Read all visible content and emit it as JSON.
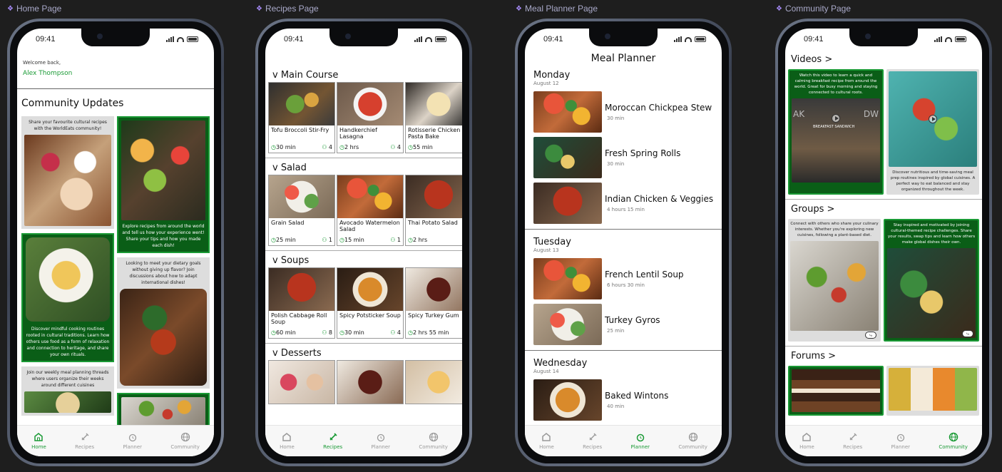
{
  "frames": [
    "Home Page",
    "Recipes Page",
    "Meal Planner Page",
    "Community Page"
  ],
  "status": {
    "time": "09:41"
  },
  "tabs": [
    "Home",
    "Recipes",
    "Planner",
    "Community"
  ],
  "colors": {
    "accent": "#1a9a35",
    "dark_green": "#0a5e17",
    "background": "#1e1e1e"
  },
  "home": {
    "welcome": "Welcome back,",
    "user": "Alex Thompson",
    "section_title": "Community Updates",
    "cards": [
      "Share your favourite cultural recipes with the WorldEats community!",
      "Explore recipes from around the world and tell us how your experience went! Share your tips and how you made each dish!",
      "Discover mindful cooking routines rooted in cultural traditions. Learn how others use food as a form of relaxation and connection to heritage, and share your own rituals.",
      "Looking to meet your dietary goals without giving up flavor? Join discussions about how to adapt international dishes!",
      "Join our weekly meal planning threads where users organize their weeks around different cuisines"
    ]
  },
  "recipes": {
    "sections": [
      {
        "title": "v Main Course",
        "items": [
          {
            "name": "Tofu Broccoli Stir-Fry",
            "time": "30 min",
            "serves": "4"
          },
          {
            "name": "Handkerchief Lasagna",
            "time": "2 hrs",
            "serves": "4"
          },
          {
            "name": "Rotisserie Chicken Pasta Bake",
            "time": "55 min",
            "serves": ""
          }
        ]
      },
      {
        "title": "v Salad",
        "items": [
          {
            "name": "Grain Salad",
            "time": "25 min",
            "serves": "1"
          },
          {
            "name": "Avocado Watermelon Salad",
            "time": "15 min",
            "serves": "1"
          },
          {
            "name": "Thai Potato Salad",
            "time": "2 hrs",
            "serves": ""
          }
        ]
      },
      {
        "title": "v Soups",
        "items": [
          {
            "name": "Polish Cabbage Roll Soup",
            "time": "60 min",
            "serves": "8"
          },
          {
            "name": "Spicy Potsticker Soup",
            "time": "30 min",
            "serves": "4"
          },
          {
            "name": "Spicy Turkey Gum",
            "time": "2 hrs 55 min",
            "serves": ""
          }
        ]
      },
      {
        "title": "v Desserts",
        "items": []
      }
    ]
  },
  "planner": {
    "title": "Meal Planner",
    "days": [
      {
        "day": "Monday",
        "date": "August 12",
        "meals": [
          {
            "name": "Moroccan Chickpea Stew",
            "time": "30 min"
          },
          {
            "name": "Fresh Spring Rolls",
            "time": "30 min"
          },
          {
            "name": "Indian Chicken & Veggies",
            "time": "4 hours 15 min"
          }
        ]
      },
      {
        "day": "Tuesday",
        "date": "August 13",
        "meals": [
          {
            "name": "French Lentil Soup",
            "time": "6 hours 30 min"
          },
          {
            "name": "Turkey Gyros",
            "time": "25 min"
          }
        ]
      },
      {
        "day": "Wednesday",
        "date": "August 14",
        "meals": [
          {
            "name": "Baked Wintons",
            "time": "40 min"
          }
        ]
      }
    ]
  },
  "community": {
    "videos": {
      "title": "Videos >",
      "card1": "Watch this video to learn a quick and calming breakfast recipe from around the world. Great for busy morning and staying connected to cultural roots.",
      "card1_overlay": "BREAKFAST SANDWICH",
      "card1_left": "AK",
      "card1_right": "DW",
      "card2": "Discover nutritious and time-saving meal prep routines inspired by global cuisines. A perfect way to eat balanced and stay organized throughout the week."
    },
    "groups": {
      "title": "Groups >",
      "card1": "Connect with others who share your culinary interests. Whether you're exploring new cuisines, following a plant-based diet.",
      "card2": "Stay inspired and motivated by joining cultural-themed recipe challenges. Share your results, swap tips and learn how others make global dishes their own."
    },
    "forums": {
      "title": "Forums >"
    }
  }
}
